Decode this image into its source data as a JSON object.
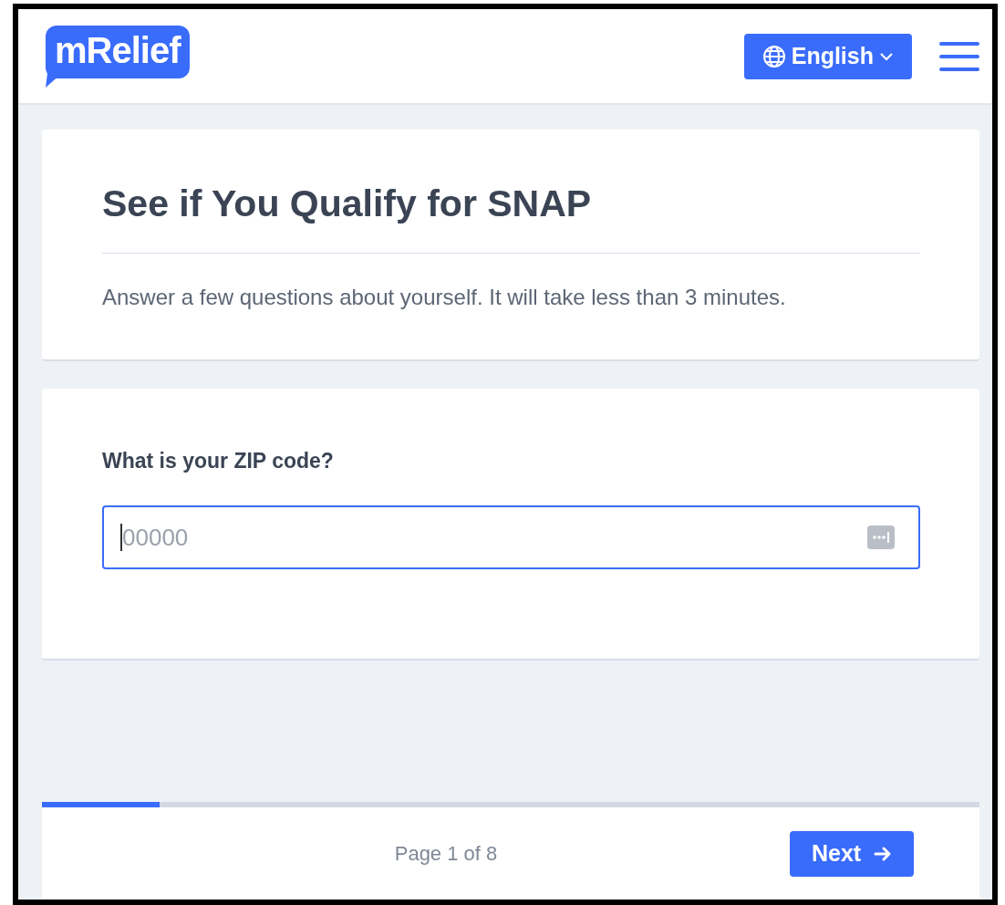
{
  "header": {
    "logo": "mRelief",
    "language_button": "English"
  },
  "intro": {
    "title": "See if You Qualify for SNAP",
    "description": "Answer a few questions about yourself. It will take less than 3 minutes."
  },
  "question": {
    "label": "What is your ZIP code?",
    "input": {
      "placeholder": "00000",
      "focused": true
    }
  },
  "progress": {
    "level": 0.125
  },
  "footer": {
    "page_label": "Page 1 of 8",
    "next_button": "Next"
  }
}
